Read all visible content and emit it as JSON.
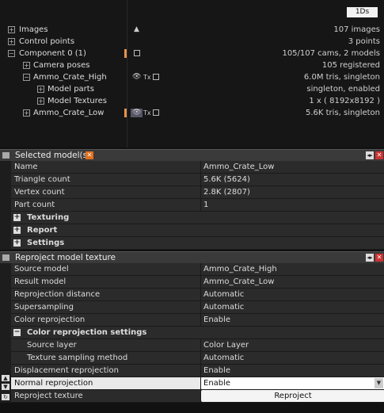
{
  "header": {
    "badge": "1Ds"
  },
  "tree": [
    {
      "label": "Images",
      "value": "107 images",
      "icon": "warning-icon"
    },
    {
      "label": "Control points",
      "value": "3 points"
    },
    {
      "label": "Component 0 (1)",
      "value": "105/107 cams, 2 models"
    },
    {
      "label": "Camera poses",
      "value": "105 registered"
    },
    {
      "label": "Ammo_Crate_High",
      "value": "6.0M tris, singleton"
    },
    {
      "label": "Model parts",
      "value": "singleton, enabled"
    },
    {
      "label": "Model Textures",
      "value": "1 x ( 8192x8192 )"
    },
    {
      "label": "Ammo_Crate_Low",
      "value": "5.6K tris, singleton"
    }
  ],
  "tex_glyph": "Tx",
  "selected_model": {
    "title": "Selected model(s)",
    "rows": [
      {
        "key": "Name",
        "value": "Ammo_Crate_Low"
      },
      {
        "key": "Triangle count",
        "value": "5.6K (5624)"
      },
      {
        "key": "Vertex count",
        "value": "2.8K (2807)"
      },
      {
        "key": "Part count",
        "value": "1"
      }
    ],
    "sections": [
      "Texturing",
      "Report",
      "Settings"
    ]
  },
  "reproject": {
    "title": "Reproject model texture",
    "rows": [
      {
        "key": "Source model",
        "value": "Ammo_Crate_High"
      },
      {
        "key": "Result model",
        "value": "Ammo_Crate_Low"
      },
      {
        "key": "Reprojection distance",
        "value": "Automatic"
      },
      {
        "key": "Supersampling",
        "value": "Automatic"
      },
      {
        "key": "Color reprojection",
        "value": "Enable"
      }
    ],
    "color_section": "Color reprojection settings",
    "color_rows": [
      {
        "key": "Source layer",
        "value": "Color Layer"
      },
      {
        "key": "Texture sampling method",
        "value": "Automatic"
      }
    ],
    "rows2": [
      {
        "key": "Displacement reprojection",
        "value": "Enable"
      },
      {
        "key": "Normal reprojection",
        "value": "Enable"
      }
    ],
    "action": {
      "key": "Reproject texture",
      "button": "Reproject"
    }
  }
}
